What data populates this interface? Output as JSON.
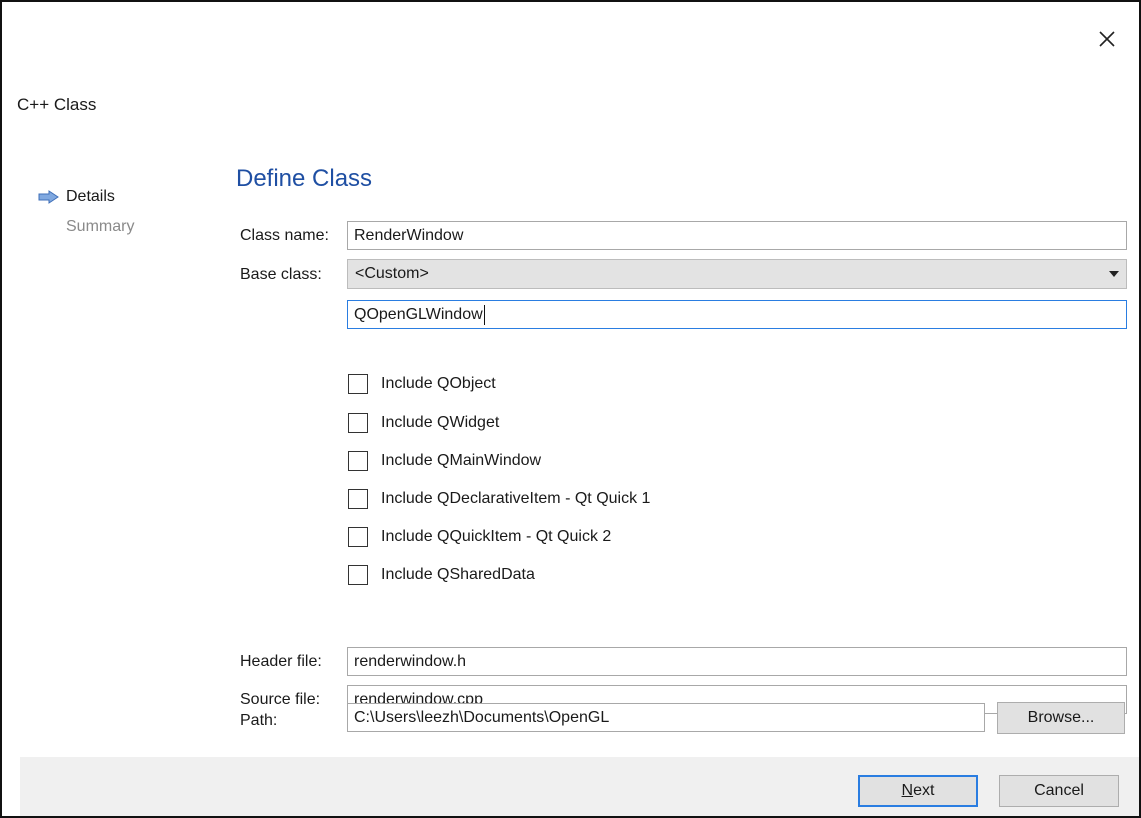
{
  "window": {
    "title": "C++ Class"
  },
  "sidebar": {
    "steps": [
      {
        "label": "Details",
        "active": true
      },
      {
        "label": "Summary",
        "active": false
      }
    ]
  },
  "page": {
    "title": "Define Class"
  },
  "form": {
    "class_name": {
      "label": "Class name:",
      "value": "RenderWindow"
    },
    "base_class": {
      "label": "Base class:",
      "selected": "<Custom>",
      "custom_value": "QOpenGLWindow"
    },
    "includes": [
      {
        "label": "Include QObject",
        "checked": false
      },
      {
        "label": "Include QWidget",
        "checked": false
      },
      {
        "label": "Include QMainWindow",
        "checked": false
      },
      {
        "label": "Include QDeclarativeItem - Qt Quick 1",
        "checked": false
      },
      {
        "label": "Include QQuickItem - Qt Quick 2",
        "checked": false
      },
      {
        "label": "Include QSharedData",
        "checked": false
      }
    ],
    "header_file": {
      "label": "Header file:",
      "value": "renderwindow.h"
    },
    "source_file": {
      "label": "Source file:",
      "value": "renderwindow.cpp"
    },
    "path": {
      "label": "Path:",
      "value": "C:\\Users\\leezh\\Documents\\OpenGL"
    },
    "browse_label": "Browse..."
  },
  "footer": {
    "next_mnemonic": "N",
    "next_rest": "ext",
    "cancel_label": "Cancel"
  },
  "colors": {
    "accent": "#1f4fa3",
    "focus": "#2a7de1",
    "footer_bg": "#f0f0f0"
  },
  "icons": {
    "close": "close-icon",
    "step": "arrow-right-icon",
    "dropdown": "chevron-down-icon"
  }
}
